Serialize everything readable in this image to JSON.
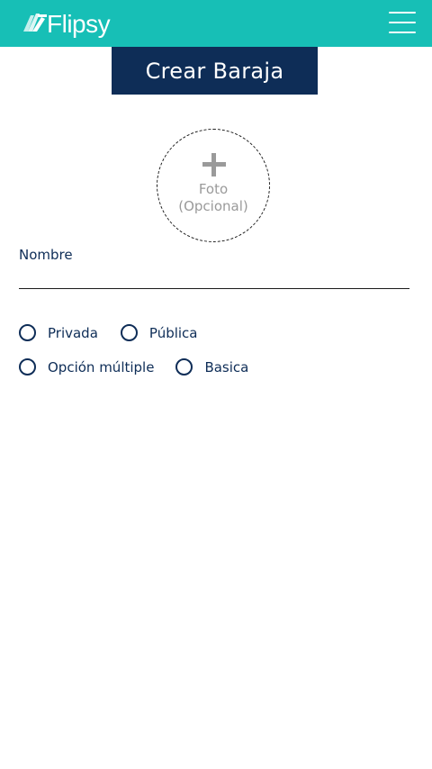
{
  "header": {
    "logo_text": "Flipsy",
    "menu_icon": "hamburger-menu-icon",
    "background_color": "#17bfb6"
  },
  "page": {
    "title": "Crear Baraja",
    "title_background": "#0e2d57"
  },
  "photo_upload": {
    "icon": "plus-icon",
    "label_line1": "Foto",
    "label_line2": "(Opcional)"
  },
  "form": {
    "name_label": "Nombre",
    "name_value": "",
    "visibility_options": [
      {
        "label": "Privada",
        "selected": false
      },
      {
        "label": "Pública",
        "selected": false
      }
    ],
    "type_options": [
      {
        "label": "Opción múltiple",
        "selected": false
      },
      {
        "label": "Basica",
        "selected": false
      }
    ]
  }
}
